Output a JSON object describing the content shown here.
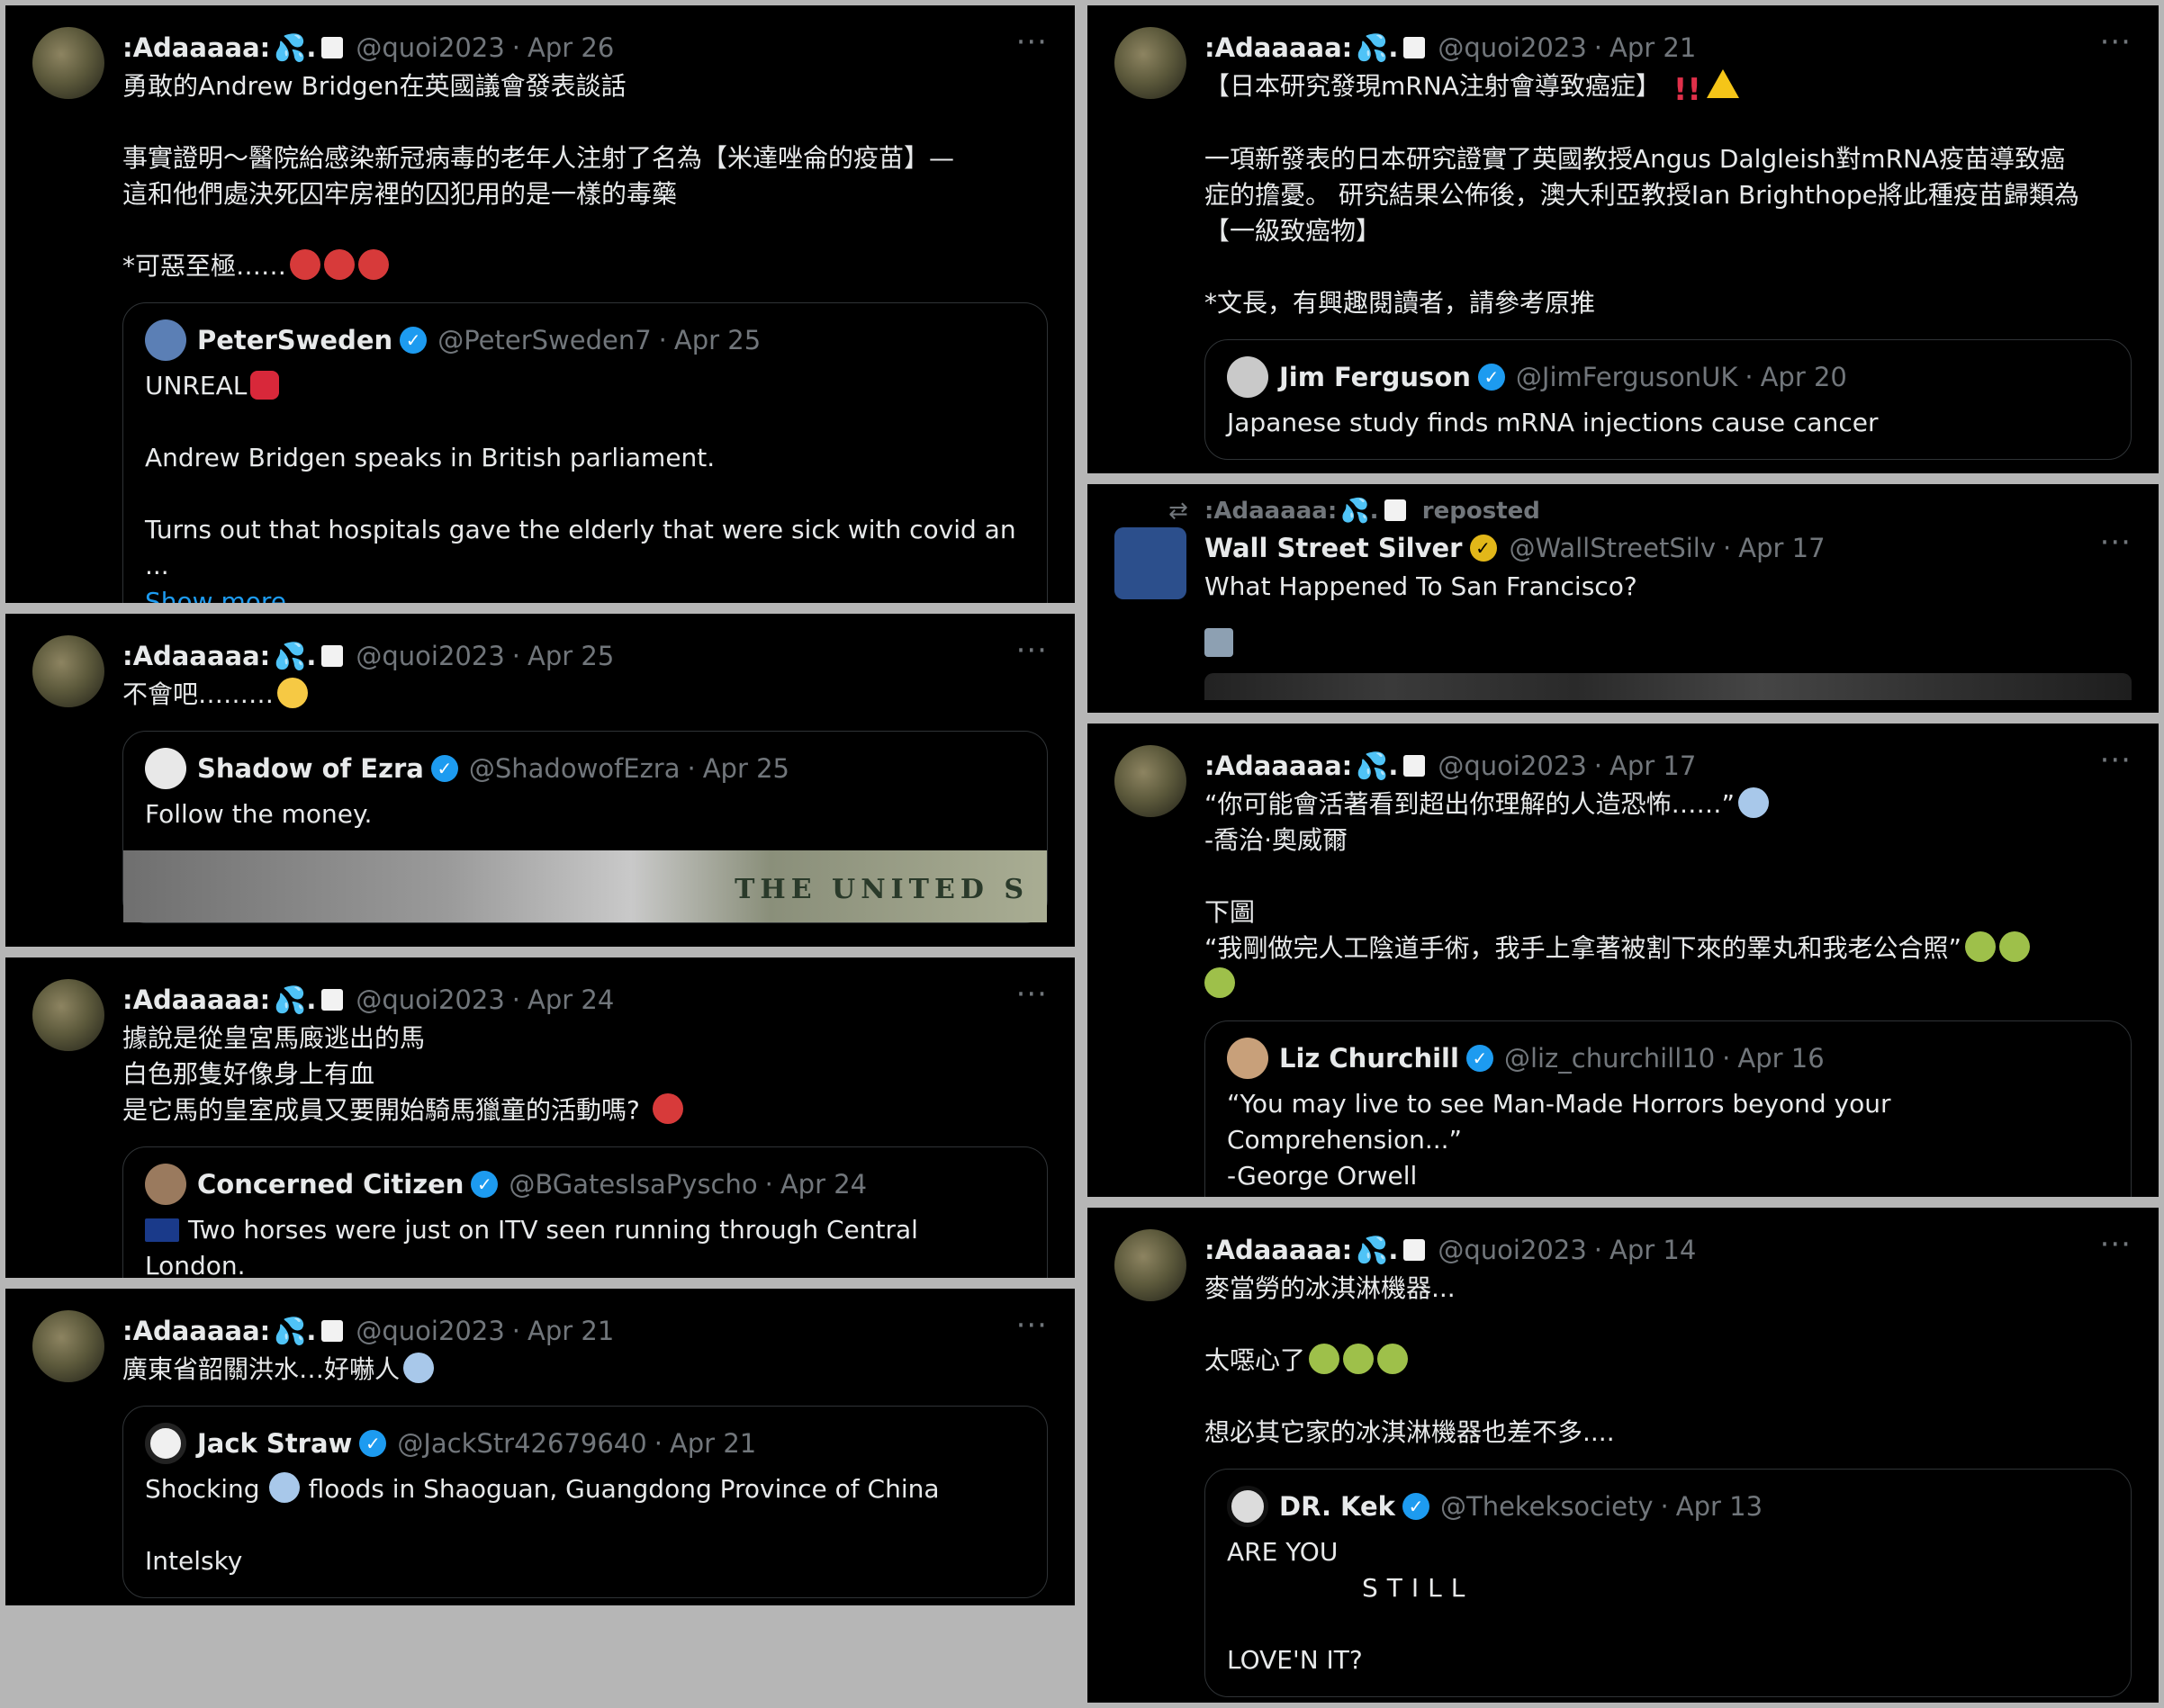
{
  "author": {
    "name": ":Adaaaaa:",
    "handle": "@quoi2023",
    "sep": "·",
    "more": "···"
  },
  "tweets": [
    {
      "date": "Apr 26",
      "lines": [
        "勇敢的Andrew Bridgen在英國議會發表談話",
        "",
        "事實證明～醫院給感染新冠病毒的老年人注射了名為【米達唑侖的疫苗】—",
        "這和他們處決死囚牢房裡的囚犯用的是一樣的毒藥",
        "",
        "*可惡至極……"
      ],
      "quote": {
        "name": "PeterSweden",
        "handle": "@PeterSweden7",
        "date": "Apr 25",
        "lines": [
          "UNREAL",
          "",
          "Andrew Bridgen speaks in British parliament.",
          "",
          "Turns out that hospitals gave the elderly that were sick with covid an ..."
        ],
        "show_more": "Show more"
      }
    },
    {
      "date": "Apr 25",
      "lines": [
        "不會吧………"
      ],
      "quote": {
        "name": "Shadow of Ezra",
        "handle": "@ShadowofEzra",
        "date": "Apr 25",
        "lines": [
          "Follow the money."
        ],
        "media_text": "THE UNITED S"
      }
    },
    {
      "date": "Apr 24",
      "lines": [
        "據說是從皇宮馬廄逃出的馬",
        "白色那隻好像身上有血",
        "是它馬的皇室成員又要開始騎馬獵童的活動嗎?"
      ],
      "quote": {
        "name": "Concerned Citizen",
        "handle": "@BGatesIsaPyscho",
        "date": "Apr 24",
        "lines": [
          "Two horses were just on ITV seen running through Central London."
        ]
      }
    },
    {
      "date": "Apr 21",
      "lines": [
        "廣東省韶關洪水…好嚇人"
      ],
      "quote": {
        "name": "Jack Straw",
        "handle": "@JackStr42679640",
        "date": "Apr 21",
        "lines_a": "Shocking",
        "lines_b": "floods in Shaoguan, Guangdong Province of China",
        "lines_c": "Intelsky"
      }
    },
    {
      "date": "Apr 21",
      "lines": [
        "【日本研究發現mRNA注射會導致癌症】",
        "",
        "一項新發表的日本研究證實了英國教授Angus Dalgleish對mRNA疫苗導致癌",
        "症的擔憂。 研究結果公佈後，澳大利亞教授Ian Brighthope將此種疫苗歸類為",
        "【一級致癌物】",
        "",
        "*文長，有興趣閱讀者，請參考原推"
      ],
      "quote": {
        "name": "Jim Ferguson",
        "handle": "@JimFergusonUK",
        "date": "Apr 20",
        "lines": [
          "Japanese study finds mRNA injections cause cancer"
        ]
      }
    },
    {
      "repost_label": "reposted",
      "name": "Wall Street Silver",
      "handle": "@WallStreetSilv",
      "date": "Apr 17",
      "lines": [
        "What Happened To San Francisco?"
      ]
    },
    {
      "date": "Apr 17",
      "lines": [
        "“你可能會活著看到超出你理解的人造恐怖……”",
        "-喬治·奧威爾",
        "",
        "下圖",
        "“我剛做完人工陰道手術，我手上拿著被割下來的睪丸和我老公合照”"
      ],
      "quote": {
        "name": "Liz Churchill",
        "handle": "@liz_churchill10",
        "date": "Apr 16",
        "lines": [
          "“You may live to see Man-Made Horrors beyond your Comprehension...”",
          "-George Orwell"
        ]
      }
    },
    {
      "date": "Apr 14",
      "lines": [
        "麥當勞的冰淇淋機器...",
        "",
        "太噁心了",
        "",
        "想必其它家的冰淇淋機器也差不多...."
      ],
      "quote": {
        "name": "DR. Kek",
        "handle": "@Thekeksociety",
        "date": "Apr 13",
        "lines": [
          "ARE YOU",
          "STILL",
          "",
          "LOVE'N IT?"
        ]
      }
    }
  ],
  "colors": {
    "background": "#000000",
    "text": "#e7e9ea",
    "muted": "#71767b",
    "link": "#1d9bf0",
    "verified": "#1d9bf0",
    "verified_gold": "#e2b719",
    "gutter": "#b6b6b6"
  },
  "icons": {
    "drop": "sweat-droplets-icon",
    "verified": "verified-badge-icon",
    "repost": "repost-icon",
    "more": "more-options-icon"
  }
}
